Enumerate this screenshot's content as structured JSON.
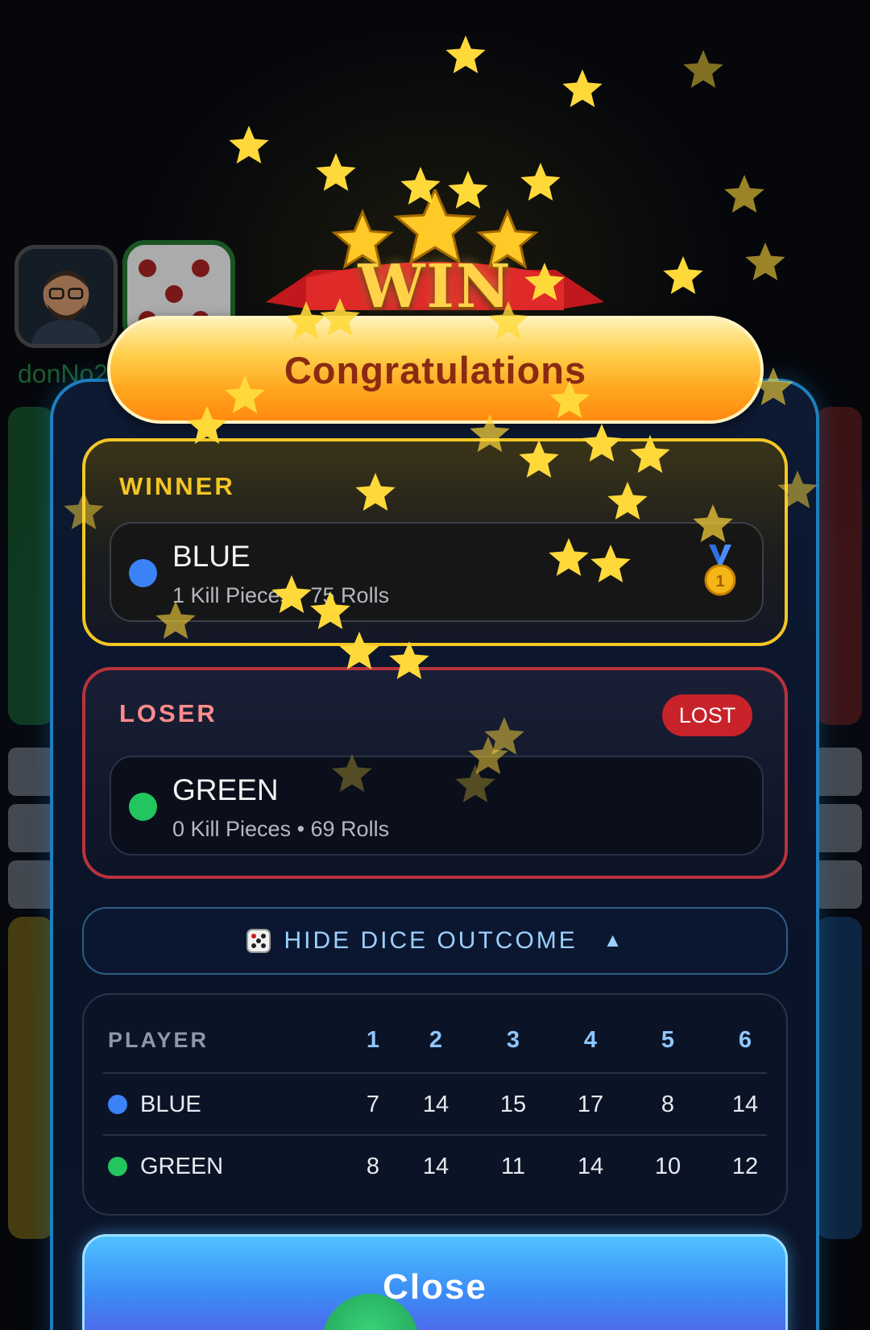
{
  "background": {
    "player_name": "donNo2"
  },
  "banner": {
    "win_text": "WIN",
    "congrats_text": "Congratulations"
  },
  "winner": {
    "title": "WINNER",
    "name": "BLUE",
    "stats": "1 Kill Pieces • 75 Rolls",
    "color": "#3b82f6",
    "medal_icon": "first-place-medal-icon"
  },
  "loser": {
    "title": "LOSER",
    "badge": "LOST",
    "name": "GREEN",
    "stats": "0 Kill Pieces • 69 Rolls",
    "color": "#22c55e"
  },
  "dice_toggle": {
    "label": "HIDE DICE OUTCOME",
    "arrow": "▲",
    "icon": "dice-icon"
  },
  "dice_table": {
    "header": [
      "PLAYER",
      "1",
      "2",
      "3",
      "4",
      "5",
      "6"
    ],
    "rows": [
      {
        "player": "BLUE",
        "color": "#3b82f6",
        "counts": [
          "7",
          "14",
          "15",
          "17",
          "8",
          "14"
        ]
      },
      {
        "player": "GREEN",
        "color": "#22c55e",
        "counts": [
          "8",
          "14",
          "11",
          "14",
          "10",
          "12"
        ]
      }
    ]
  },
  "close_button": {
    "label": "Close"
  },
  "colors": {
    "gold": "#f3c623",
    "loser_red": "#b8333d",
    "accent_blue": "#1e7fbf"
  }
}
